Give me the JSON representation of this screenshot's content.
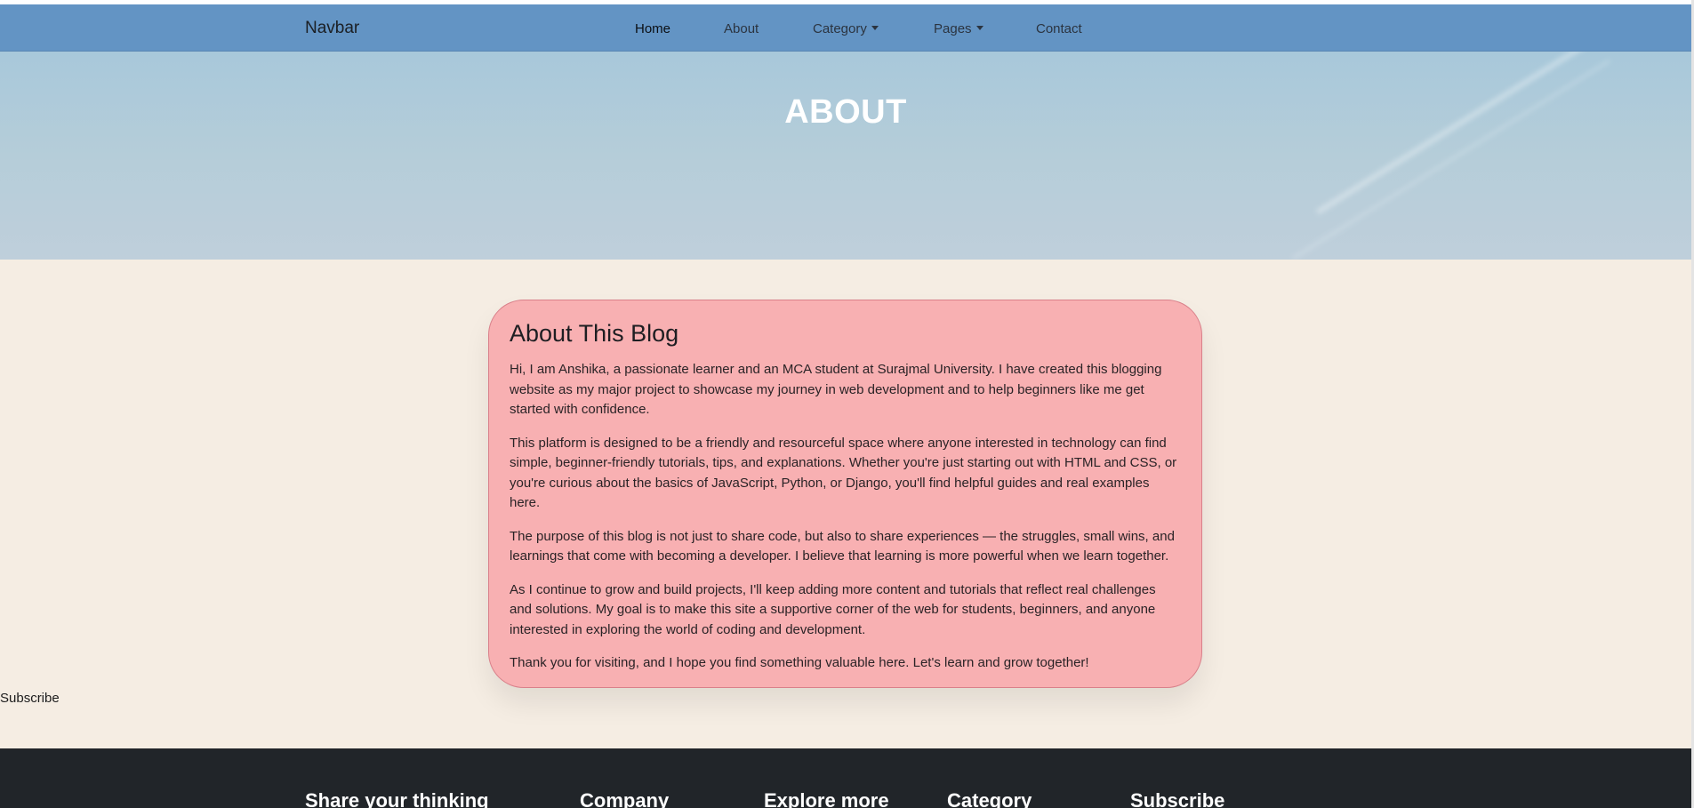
{
  "navbar": {
    "brand": "Navbar",
    "links": [
      {
        "label": "Home"
      },
      {
        "label": "About"
      },
      {
        "label": "Category"
      },
      {
        "label": "Pages"
      },
      {
        "label": "Contact"
      }
    ]
  },
  "hero": {
    "title": "ABOUT"
  },
  "about": {
    "title": "About This Blog",
    "paragraphs": [
      "Hi, I am Anshika, a passionate learner and an MCA student at Surajmal University. I have created this blogging website as my major project to showcase my journey in web development and to help beginners like me get started with confidence.",
      "This platform is designed to be a friendly and resourceful space where anyone interested in technology can find simple, beginner-friendly tutorials, tips, and explanations. Whether you're just starting out with HTML and CSS, or you're curious about the basics of JavaScript, Python, or Django, you'll find helpful guides and real examples here.",
      "The purpose of this blog is not just to share code, but also to share experiences — the struggles, small wins, and learnings that come with becoming a developer. I believe that learning is more powerful when we learn together.",
      "As I continue to grow and build projects, I'll keep adding more content and tutorials that reflect real challenges and solutions. My goal is to make this site a supportive corner of the web for students, beginners, and anyone interested in exploring the world of coding and development.",
      "Thank you for visiting, and I hope you find something valuable here. Let's learn and grow together!"
    ]
  },
  "subscribe_label": "Subscribe",
  "footer": {
    "headings": [
      "Share your thinking",
      "Company",
      "Explore more",
      "Category",
      "Subscribe"
    ]
  }
}
